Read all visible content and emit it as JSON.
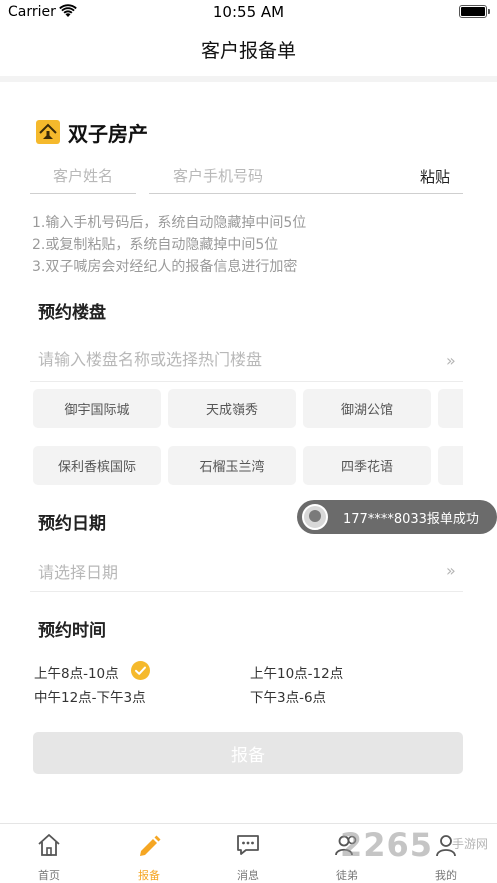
{
  "status_bar": {
    "carrier": "Carrier",
    "time": "10:55 AM"
  },
  "nav": {
    "title": "客户报备单"
  },
  "brand": {
    "name": "双子房产",
    "color": "#f5b92c"
  },
  "form": {
    "name_placeholder": "客户姓名",
    "phone_placeholder": "客户手机号码",
    "paste_label": "粘贴",
    "notes": [
      "1.输入手机号码后，系统自动隐藏掉中间5位",
      "2.或复制粘贴，系统自动隐藏掉中间5位",
      "3.双子喊房会对经纪人的报备信息进行加密"
    ]
  },
  "property": {
    "title": "预约楼盘",
    "search_placeholder": "请输入楼盘名称或选择热门楼盘",
    "chevron": "»",
    "chips_row1": [
      "御宇国际城",
      "天成嶺秀",
      "御湖公馆",
      ""
    ],
    "chips_row2": [
      "保利香槟国际",
      "石榴玉兰湾",
      "四季花语",
      ""
    ]
  },
  "date": {
    "title": "预约日期",
    "placeholder": "请选择日期",
    "chevron": "»"
  },
  "toast": {
    "text": "177****8033报单成功"
  },
  "time": {
    "title": "预约时间",
    "options": [
      "上午8点-10点",
      "上午10点-12点",
      "中午12点-下午3点",
      "下午3点-6点"
    ],
    "selected_index": 0
  },
  "submit": {
    "label": "报备"
  },
  "tabs": [
    {
      "label": "首页",
      "icon": "home-icon"
    },
    {
      "label": "报备",
      "icon": "pencil-icon",
      "active": true
    },
    {
      "label": "消息",
      "icon": "message-icon"
    },
    {
      "label": "徒弟",
      "icon": "people-icon"
    },
    {
      "label": "我的",
      "icon": "person-icon"
    }
  ],
  "watermark": {
    "text": "2265",
    "sub": "手游网"
  },
  "colors": {
    "accent": "#f5b92c",
    "active_tab": "#f5a623",
    "disabled_button": "#e6e6e6"
  }
}
